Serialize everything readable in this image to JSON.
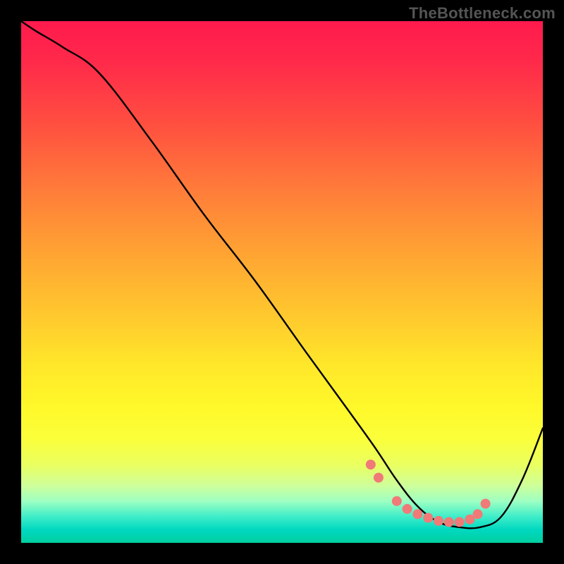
{
  "attribution": "TheBottleneck.com",
  "colors": {
    "page_bg": "#000000",
    "curve": "#000000",
    "bead": "#f07a78"
  },
  "chart_data": {
    "type": "line",
    "title": "",
    "xlabel": "",
    "ylabel": "",
    "xlim": [
      0,
      100
    ],
    "ylim": [
      0,
      100
    ],
    "series": [
      {
        "name": "bottleneck-curve",
        "x": [
          0,
          3,
          8,
          15,
          25,
          35,
          45,
          55,
          63,
          68,
          72,
          76,
          80,
          84,
          88,
          92,
          96,
          100
        ],
        "y": [
          100,
          98,
          95,
          90,
          77,
          63,
          50,
          36,
          25,
          18,
          12,
          7,
          4,
          3,
          3,
          5,
          12,
          22
        ]
      }
    ],
    "markers": {
      "name": "highlight-beads",
      "x": [
        67,
        68.5,
        72,
        74,
        76,
        78,
        80,
        82,
        84,
        86,
        87.5,
        89
      ],
      "y": [
        15,
        12.5,
        8,
        6.5,
        5.5,
        4.8,
        4.2,
        4.0,
        4.0,
        4.5,
        5.5,
        7.5
      ]
    }
  }
}
